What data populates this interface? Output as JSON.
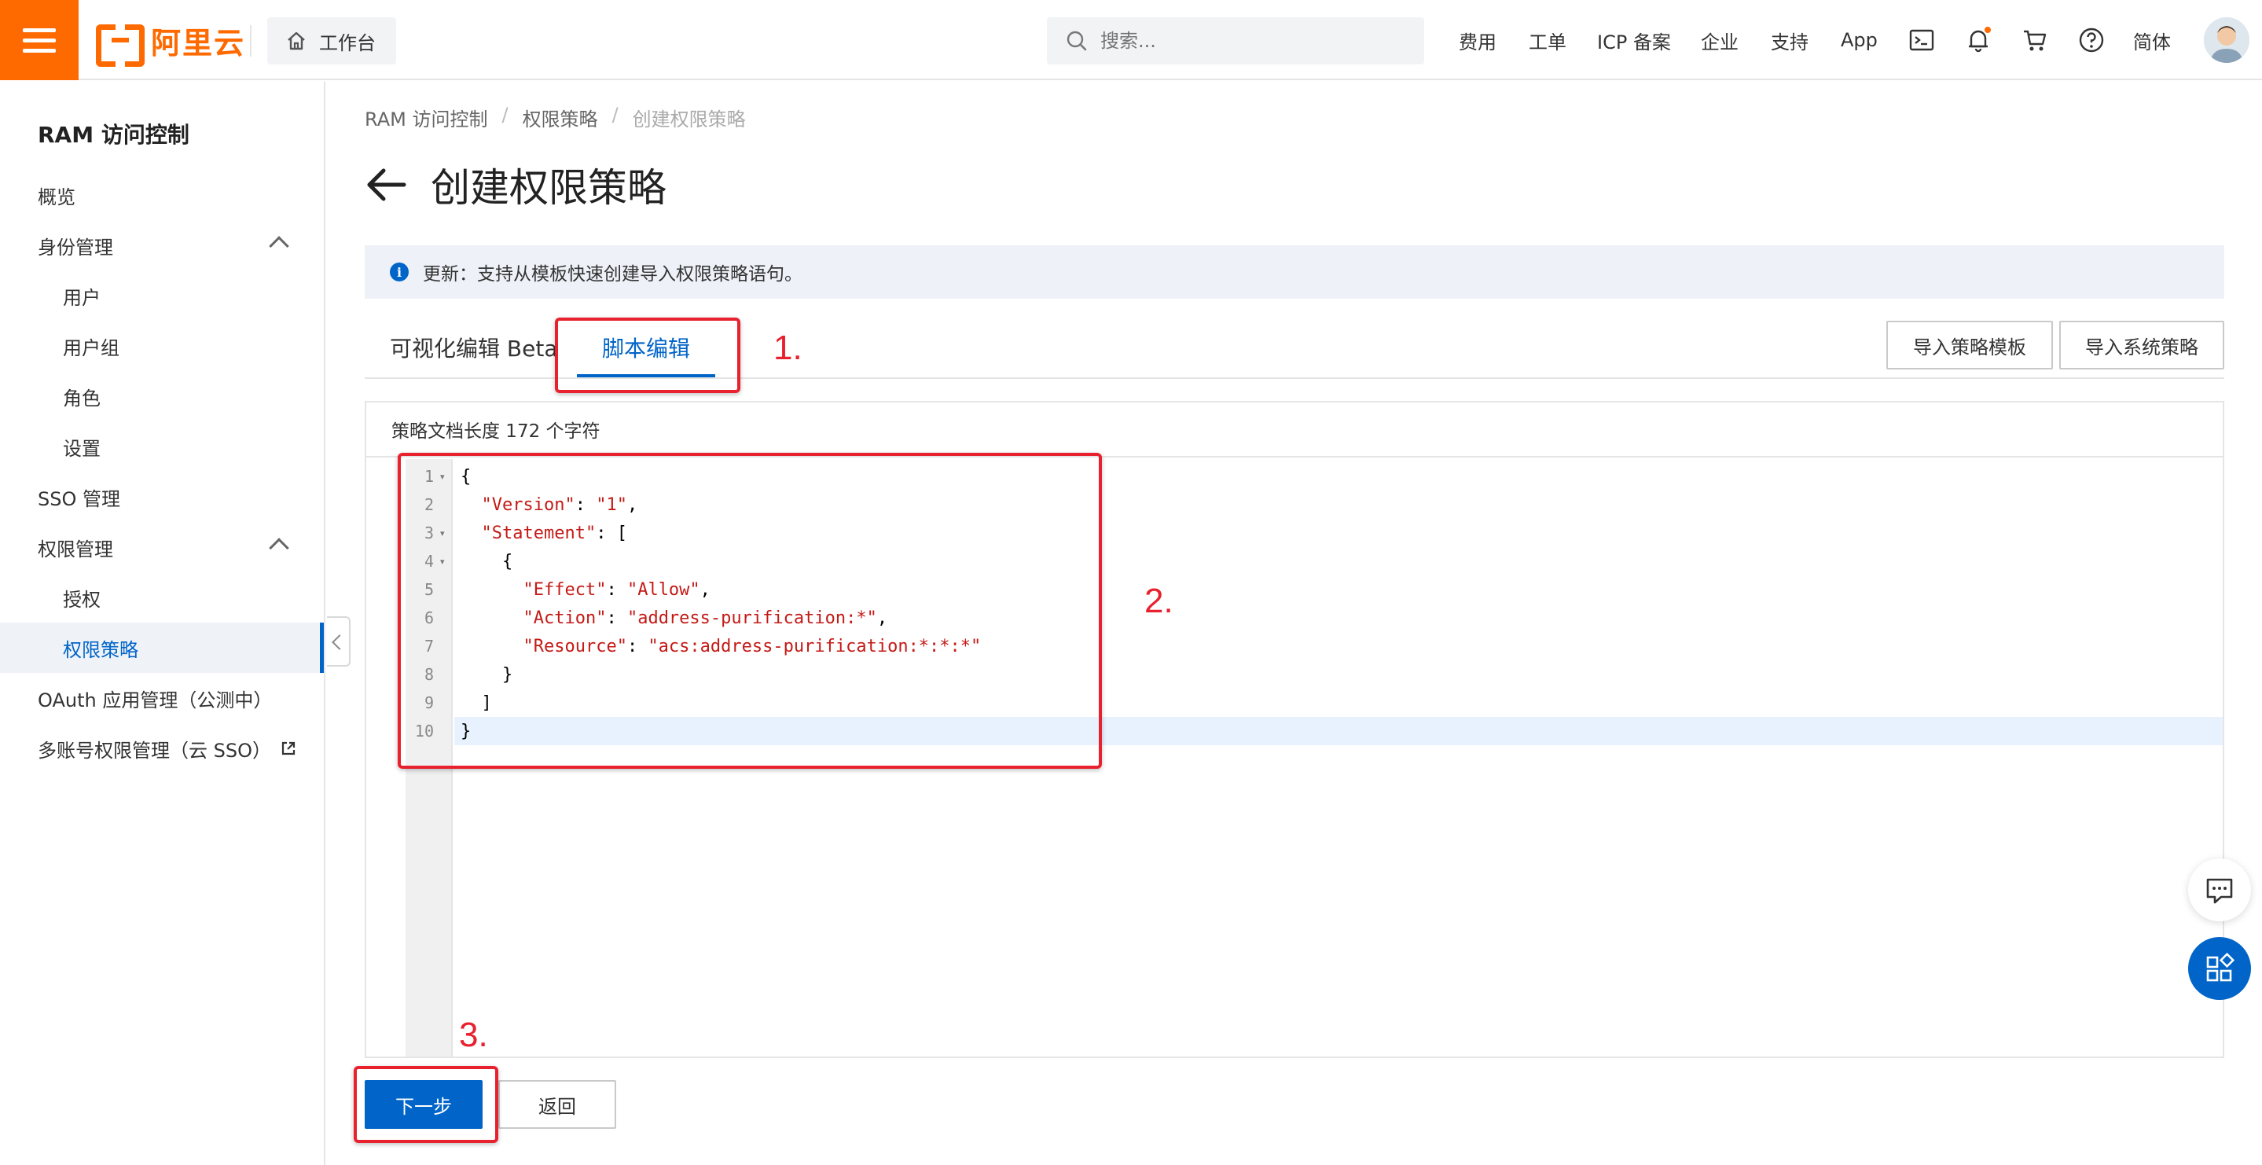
{
  "topbar": {
    "logo_text": "阿里云",
    "workbench_label": "工作台",
    "search_placeholder": "搜索...",
    "nav": {
      "billing": "费用",
      "tickets": "工单",
      "icp": "ICP 备案",
      "enterprise": "企业",
      "support": "支持",
      "app": "App",
      "language": "简体"
    },
    "colors": {
      "brand": "#ff6a00"
    }
  },
  "sidebar": {
    "title": "RAM 访问控制",
    "items": [
      {
        "label": "概览"
      },
      {
        "label": "身份管理"
      },
      {
        "label": "用户"
      },
      {
        "label": "用户组"
      },
      {
        "label": "角色"
      },
      {
        "label": "设置"
      },
      {
        "label": "SSO 管理"
      },
      {
        "label": "权限管理"
      },
      {
        "label": "授权"
      },
      {
        "label": "权限策略"
      },
      {
        "label": "OAuth 应用管理（公测中）"
      },
      {
        "label": "多账号权限管理（云 SSO）"
      }
    ],
    "active_item": "权限策略"
  },
  "breadcrumb": {
    "items": [
      "RAM 访问控制",
      "权限策略",
      "创建权限策略"
    ],
    "separator": "/"
  },
  "page": {
    "title": "创建权限策略",
    "notice": "更新：支持从模板快速创建导入权限策略语句。"
  },
  "tabs": {
    "visual": "可视化编辑 Beta",
    "script": "脚本编辑"
  },
  "actions": {
    "import_template": "导入策略模板",
    "import_system": "导入系统策略"
  },
  "editor": {
    "header": "策略文档长度 172 个字符",
    "line_numbers": [
      "1",
      "2",
      "3",
      "4",
      "5",
      "6",
      "7",
      "8",
      "9",
      "10"
    ],
    "lines": [
      {
        "indent": "",
        "key": "",
        "sep": "",
        "val": "",
        "tail": "{"
      },
      {
        "indent": "  ",
        "key": "\"Version\"",
        "sep": ": ",
        "val": "\"1\"",
        "tail": ","
      },
      {
        "indent": "  ",
        "key": "\"Statement\"",
        "sep": ": ",
        "val": "",
        "tail": "["
      },
      {
        "indent": "    ",
        "key": "",
        "sep": "",
        "val": "",
        "tail": "{"
      },
      {
        "indent": "      ",
        "key": "\"Effect\"",
        "sep": ": ",
        "val": "\"Allow\"",
        "tail": ","
      },
      {
        "indent": "      ",
        "key": "\"Action\"",
        "sep": ": ",
        "val": "\"address-purification:*\"",
        "tail": ","
      },
      {
        "indent": "      ",
        "key": "\"Resource\"",
        "sep": ": ",
        "val": "\"acs:address-purification:*:*:*\"",
        "tail": ""
      },
      {
        "indent": "    ",
        "key": "",
        "sep": "",
        "val": "",
        "tail": "}"
      },
      {
        "indent": "  ",
        "key": "",
        "sep": "",
        "val": "",
        "tail": "]"
      },
      {
        "indent": "",
        "key": "",
        "sep": "",
        "val": "",
        "tail": "}"
      }
    ]
  },
  "footer": {
    "next": "下一步",
    "back": "返回"
  },
  "annotations": {
    "step1": "1.",
    "step2": "2.",
    "step3": "3.",
    "color": "#e8212f"
  },
  "colors": {
    "primary": "#0064c8",
    "notice_bg": "#eef2f8"
  }
}
